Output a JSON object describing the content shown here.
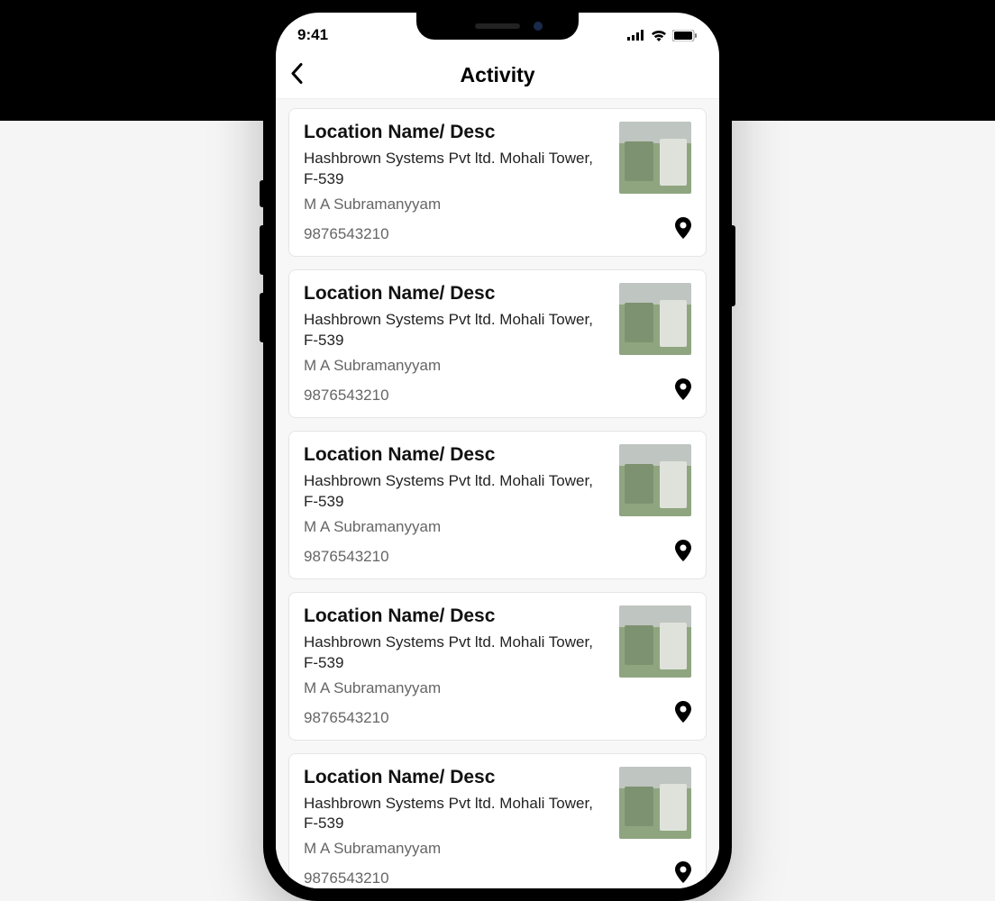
{
  "status": {
    "time": "9:41"
  },
  "nav": {
    "title": "Activity"
  },
  "cards": [
    {
      "title": "Location Name/ Desc",
      "address": "Hashbrown Systems Pvt ltd. Mohali Tower, F-539",
      "contact": "M A Subramanyyam",
      "phone": "9876543210"
    },
    {
      "title": "Location Name/ Desc",
      "address": "Hashbrown Systems Pvt ltd. Mohali Tower, F-539",
      "contact": "M A Subramanyyam",
      "phone": "9876543210"
    },
    {
      "title": "Location Name/ Desc",
      "address": "Hashbrown Systems Pvt ltd. Mohali Tower, F-539",
      "contact": "M A Subramanyyam",
      "phone": "9876543210"
    },
    {
      "title": "Location Name/ Desc",
      "address": "Hashbrown Systems Pvt ltd. Mohali Tower, F-539",
      "contact": "M A Subramanyyam",
      "phone": "9876543210"
    },
    {
      "title": "Location Name/ Desc",
      "address": "Hashbrown Systems Pvt ltd. Mohali Tower, F-539",
      "contact": "M A Subramanyyam",
      "phone": "9876543210"
    }
  ]
}
